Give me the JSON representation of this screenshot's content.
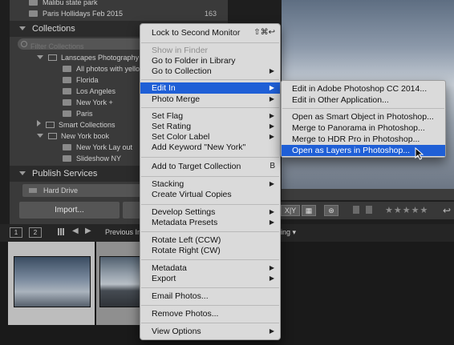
{
  "folders": {
    "rows": [
      {
        "label": "Malibu state park",
        "count": ""
      },
      {
        "label": "Paris Hollidays Feb 2015",
        "count": "163"
      }
    ]
  },
  "collections": {
    "title": "Collections",
    "filter_placeholder": "Filter Collections",
    "items": [
      {
        "label": "Lanscapes Photography"
      },
      {
        "label": "All photos with yellow"
      },
      {
        "label": "Florida"
      },
      {
        "label": "Los Angeles"
      },
      {
        "label": "New York +"
      },
      {
        "label": "Paris"
      },
      {
        "label": "Smart Collections"
      },
      {
        "label": "New York book"
      },
      {
        "label": "New York Lay out"
      },
      {
        "label": "Slideshow NY"
      }
    ]
  },
  "publish": {
    "title": "Publish Services",
    "hard_drive": "Hard Drive"
  },
  "bottom_left": {
    "import_label": "Import..."
  },
  "toolbar": {
    "stars": "★★★★★",
    "buttons": [
      "X|Y",
      "▦",
      "⊛"
    ]
  },
  "filmstrip": {
    "page1": "1",
    "page2": "2",
    "previous_label": "Previous Im",
    "sort_label": "ding ▾"
  },
  "context_menu": {
    "items": [
      {
        "label": "Lock to Second Monitor",
        "shortcut": "⇧⌘↩",
        "state": "normal"
      },
      {
        "label": "Show in Finder",
        "state": "disabled"
      },
      {
        "label": "Go to Folder in Library",
        "state": "normal"
      },
      {
        "label": "Go to Collection",
        "state": "normal",
        "submenu": true
      },
      {
        "label": "Edit In",
        "state": "active",
        "submenu": true
      },
      {
        "label": "Photo Merge",
        "state": "normal",
        "submenu": true
      },
      {
        "label": "Set Flag",
        "state": "normal",
        "submenu": true
      },
      {
        "label": "Set Rating",
        "state": "normal",
        "submenu": true
      },
      {
        "label": "Set Color Label",
        "state": "normal",
        "submenu": true
      },
      {
        "label": "Add Keyword \"New York\"",
        "state": "normal"
      },
      {
        "label": "Add to Target Collection",
        "shortcut": "B",
        "state": "normal"
      },
      {
        "label": "Stacking",
        "state": "normal",
        "submenu": true
      },
      {
        "label": "Create Virtual Copies",
        "state": "normal"
      },
      {
        "label": "Develop Settings",
        "state": "normal",
        "submenu": true
      },
      {
        "label": "Metadata Presets",
        "state": "normal",
        "submenu": true
      },
      {
        "label": "Rotate Left (CCW)",
        "state": "normal"
      },
      {
        "label": "Rotate Right (CW)",
        "state": "normal"
      },
      {
        "label": "Metadata",
        "state": "normal",
        "submenu": true
      },
      {
        "label": "Export",
        "state": "normal",
        "submenu": true
      },
      {
        "label": "Email Photos...",
        "state": "normal"
      },
      {
        "label": "Remove Photos...",
        "state": "normal"
      },
      {
        "label": "View Options",
        "state": "normal",
        "submenu": true
      }
    ]
  },
  "edit_in_submenu": {
    "items": [
      {
        "label": "Edit in Adobe Photoshop CC 2014...",
        "state": "normal"
      },
      {
        "label": "Edit in Other Application...",
        "state": "normal"
      },
      {
        "label": "Open as Smart Object in Photoshop...",
        "state": "normal"
      },
      {
        "label": "Merge to Panorama in Photoshop...",
        "state": "normal"
      },
      {
        "label": "Merge to HDR Pro in Photoshop...",
        "state": "normal"
      },
      {
        "label": "Open as Layers in Photoshop...",
        "state": "active"
      }
    ]
  },
  "colors": {
    "menu_bg": "#dadada",
    "highlight": "#1f5fd6",
    "panel_bg": "#3a3a3a"
  }
}
